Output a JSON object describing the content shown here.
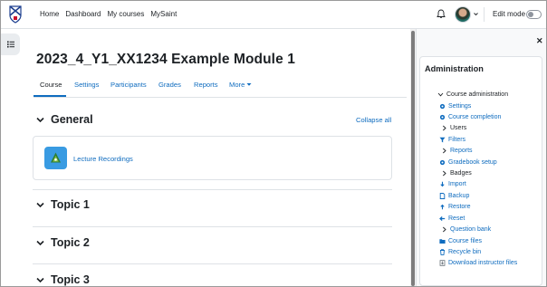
{
  "navbar": {
    "links": [
      "Home",
      "Dashboard",
      "My courses",
      "MySaint"
    ],
    "edit_mode_label": "Edit mode"
  },
  "course": {
    "title": "2023_4_Y1_XX1234 Example Module 1",
    "tabs": [
      "Course",
      "Settings",
      "Participants",
      "Grades",
      "Reports",
      "More"
    ],
    "active_tab": "Course",
    "collapse_all_label": "Collapse all",
    "sections": [
      "General",
      "Topic 1",
      "Topic 2",
      "Topic 3"
    ],
    "activity": {
      "name": "Lecture Recordings",
      "icon": "activity-link-icon"
    }
  },
  "administration": {
    "title": "Administration",
    "items": [
      {
        "label": "Course administration",
        "icon": "chevron-down-icon"
      },
      {
        "label": "Settings",
        "icon": "gear-icon"
      },
      {
        "label": "Course completion",
        "icon": "gear-icon"
      },
      {
        "label": "Users",
        "icon": "chevron-right-icon"
      },
      {
        "label": "Filters",
        "icon": "filter-icon"
      },
      {
        "label": "Reports",
        "icon": "chevron-right-icon"
      },
      {
        "label": "Gradebook setup",
        "icon": "gear-icon"
      },
      {
        "label": "Badges",
        "icon": "chevron-right-icon"
      },
      {
        "label": "Import",
        "icon": "import-icon"
      },
      {
        "label": "Backup",
        "icon": "file-icon"
      },
      {
        "label": "Restore",
        "icon": "restore-icon"
      },
      {
        "label": "Reset",
        "icon": "arrow-left-icon"
      },
      {
        "label": "Question bank",
        "icon": "chevron-right-icon"
      },
      {
        "label": "Course files",
        "icon": "folder-icon"
      },
      {
        "label": "Recycle bin",
        "icon": "trash-icon"
      },
      {
        "label": "Download instructor files",
        "icon": "download-icon"
      }
    ]
  },
  "colors": {
    "link": "#0f6cbf",
    "text": "#1d2125",
    "border": "#dee2e6"
  }
}
